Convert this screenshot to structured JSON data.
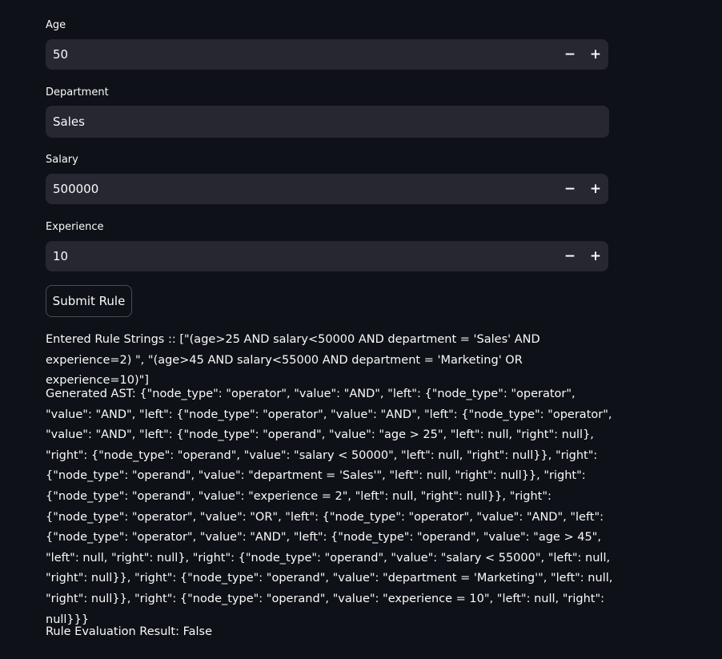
{
  "form": {
    "age": {
      "label": "Age",
      "value": "50",
      "minus_symbol": "−",
      "plus_symbol": "+"
    },
    "department": {
      "label": "Department",
      "value": "Sales"
    },
    "salary": {
      "label": "Salary",
      "value": "500000",
      "minus_symbol": "−",
      "plus_symbol": "+"
    },
    "experience": {
      "label": "Experience",
      "value": "10",
      "minus_symbol": "−",
      "plus_symbol": "+"
    },
    "submit_label": "Submit Rule"
  },
  "output": {
    "entered_rules": "Entered Rule Strings :: [\"(age>25 AND salary<50000 AND department = 'Sales' AND experience=2) \", \"(age>45 AND salary<55000 AND department = 'Marketing' OR experience=10)\"]",
    "generated_ast": "Generated AST: {\"node_type\": \"operator\", \"value\": \"AND\", \"left\": {\"node_type\": \"operator\", \"value\": \"AND\", \"left\": {\"node_type\": \"operator\", \"value\": \"AND\", \"left\": {\"node_type\": \"operator\", \"value\": \"AND\", \"left\": {\"node_type\": \"operand\", \"value\": \"age > 25\", \"left\": null, \"right\": null}, \"right\": {\"node_type\": \"operand\", \"value\": \"salary < 50000\", \"left\": null, \"right\": null}}, \"right\": {\"node_type\": \"operand\", \"value\": \"department = 'Sales'\", \"left\": null, \"right\": null}}, \"right\": {\"node_type\": \"operand\", \"value\": \"experience = 2\", \"left\": null, \"right\": null}}, \"right\": {\"node_type\": \"operator\", \"value\": \"OR\", \"left\": {\"node_type\": \"operator\", \"value\": \"AND\", \"left\": {\"node_type\": \"operator\", \"value\": \"AND\", \"left\": {\"node_type\": \"operand\", \"value\": \"age > 45\", \"left\": null, \"right\": null}, \"right\": {\"node_type\": \"operand\", \"value\": \"salary < 55000\", \"left\": null, \"right\": null}}, \"right\": {\"node_type\": \"operand\", \"value\": \"department = 'Marketing'\", \"left\": null, \"right\": null}}, \"right\": {\"node_type\": \"operand\", \"value\": \"experience = 10\", \"left\": null, \"right\": null}}}",
    "evaluation_result": "Rule Evaluation Result: False"
  }
}
